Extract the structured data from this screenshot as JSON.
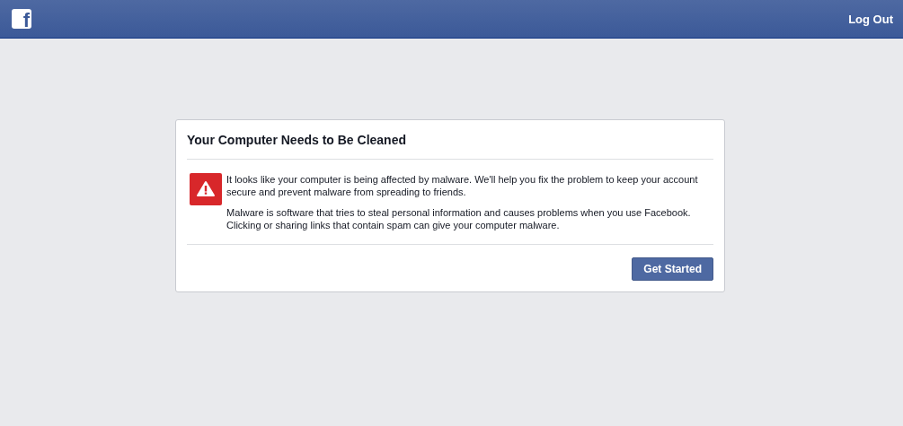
{
  "header": {
    "logo": "f",
    "logout": "Log Out"
  },
  "dialog": {
    "title": "Your Computer Needs to Be Cleaned",
    "paragraphs": [
      "It looks like your computer is being affected by malware. We'll help you fix the problem to keep your account secure and prevent malware from spreading to friends.",
      "Malware is software that tries to steal personal information and causes problems when you use Facebook. Clicking or sharing links that contain spam can give your computer malware."
    ],
    "button": "Get Started"
  }
}
